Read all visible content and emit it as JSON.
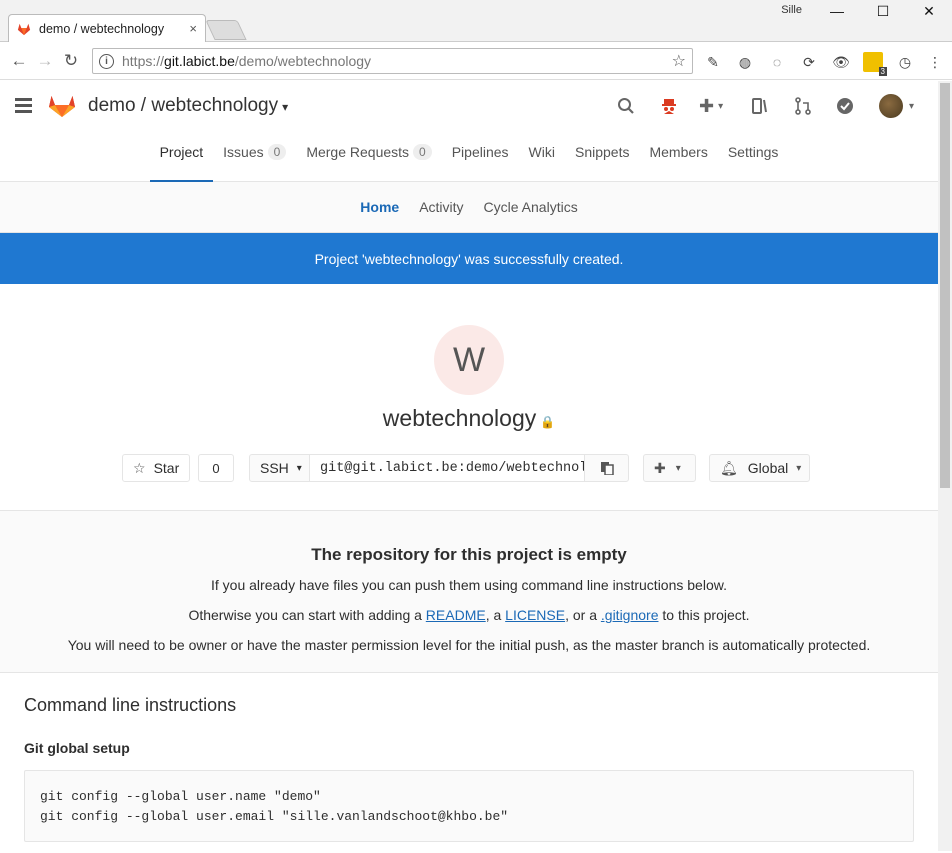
{
  "browser": {
    "tab_title": "demo / webtechnology",
    "tab_close": "×",
    "window_user": "Sille",
    "url_scheme": "https://",
    "url_host": "git.labict.be",
    "url_path": "/demo/webtechnology",
    "ext_badge": "3"
  },
  "header": {
    "project_path": "demo / webtechnology",
    "caret": "▾"
  },
  "project_nav": {
    "items": [
      {
        "label": "Project"
      },
      {
        "label": "Issues",
        "count": "0"
      },
      {
        "label": "Merge Requests",
        "count": "0"
      },
      {
        "label": "Pipelines"
      },
      {
        "label": "Wiki"
      },
      {
        "label": "Snippets"
      },
      {
        "label": "Members"
      },
      {
        "label": "Settings"
      }
    ]
  },
  "sub_nav": {
    "items": [
      {
        "label": "Home"
      },
      {
        "label": "Activity"
      },
      {
        "label": "Cycle Analytics"
      }
    ]
  },
  "flash": "Project 'webtechnology' was successfully created.",
  "project": {
    "avatar_letter": "W",
    "name": "webtechnology",
    "star_label": "Star",
    "star_count": "0",
    "protocol": "SSH",
    "clone_url": "git@git.labict.be:demo/webtechnol",
    "notification": "Global"
  },
  "empty_repo": {
    "title": "The repository for this project is empty",
    "line1": "If you already have files you can push them using command line instructions below.",
    "line2_pre": "Otherwise you can start with adding a ",
    "readme": "README",
    "line2_mid1": ", a ",
    "license": "LICENSE",
    "line2_mid2": ", or a ",
    "gitignore": ".gitignore",
    "line2_post": " to this project.",
    "line3": "You will need to be owner or have the master permission level for the initial push, as the master branch is automatically protected."
  },
  "cli": {
    "title": "Command line instructions",
    "subtitle": "Git global setup",
    "line1": "git config --global user.name \"demo\"",
    "line2": "git config --global user.email \"sille.vanlandschoot@khbo.be\""
  }
}
